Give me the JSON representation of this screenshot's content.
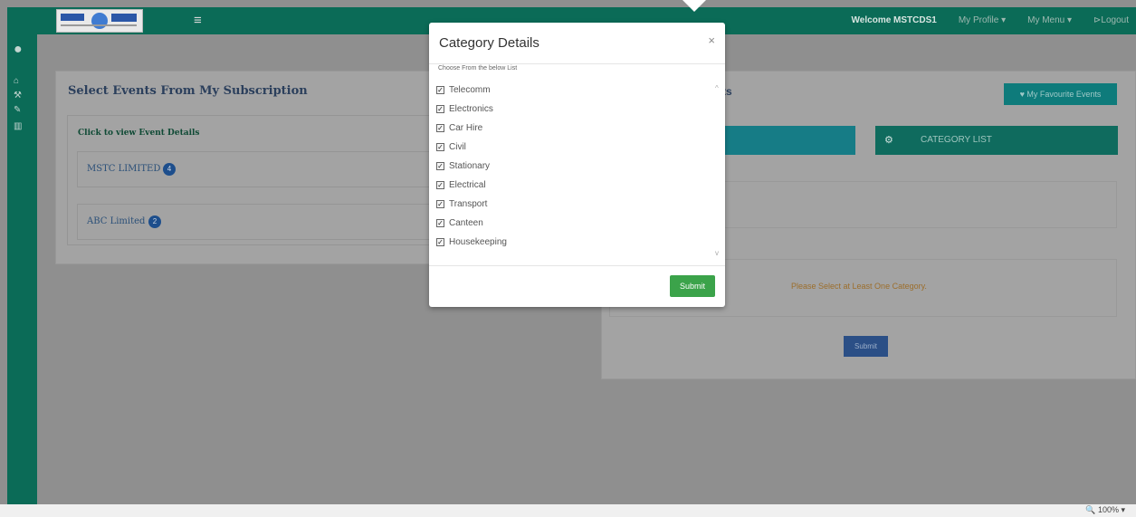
{
  "nav": {
    "menu_icon": "hamburger-icon",
    "welcome": "Welcome MSTCDS1",
    "my_profile": "My Profile ▾",
    "my_menu": "My Menu ▾",
    "logout": "⊳Logout"
  },
  "sidebar": {
    "icons": [
      "user-icon",
      "home-icon",
      "gavel-icon",
      "edit-icon",
      "chart-icon"
    ]
  },
  "left_panel": {
    "title": "Select Events From My Subscription",
    "click_label": "Click to view Event Details",
    "rows": [
      {
        "label": "MSTC LIMITED",
        "badge": "4"
      },
      {
        "label": "ABC Limited",
        "badge": "2"
      }
    ]
  },
  "right_panel": {
    "title_tail": "ts",
    "fav_button": "♥ My Favourite Events",
    "category_tab": "CATEGORY LIST",
    "warning": "Please Select at Least One Category.",
    "submit": "Submit"
  },
  "modal": {
    "title": "Category Details",
    "close": "×",
    "choose_label": "Choose From the below List",
    "categories": [
      {
        "label": "Telecomm",
        "checked": true
      },
      {
        "label": "Electronics",
        "checked": true
      },
      {
        "label": "Car Hire",
        "checked": true
      },
      {
        "label": "Civil",
        "checked": true
      },
      {
        "label": "Stationary",
        "checked": true
      },
      {
        "label": "Electrical",
        "checked": true
      },
      {
        "label": "Transport",
        "checked": true
      },
      {
        "label": "Canteen",
        "checked": true
      },
      {
        "label": "Housekeeping",
        "checked": true
      }
    ],
    "submit": "Submit"
  },
  "statusbar": {
    "zoom": "100%"
  },
  "colors": {
    "nav_green": "#0b6b57",
    "submit_green": "#3ba34a",
    "submit_blue": "#2b4f86"
  }
}
